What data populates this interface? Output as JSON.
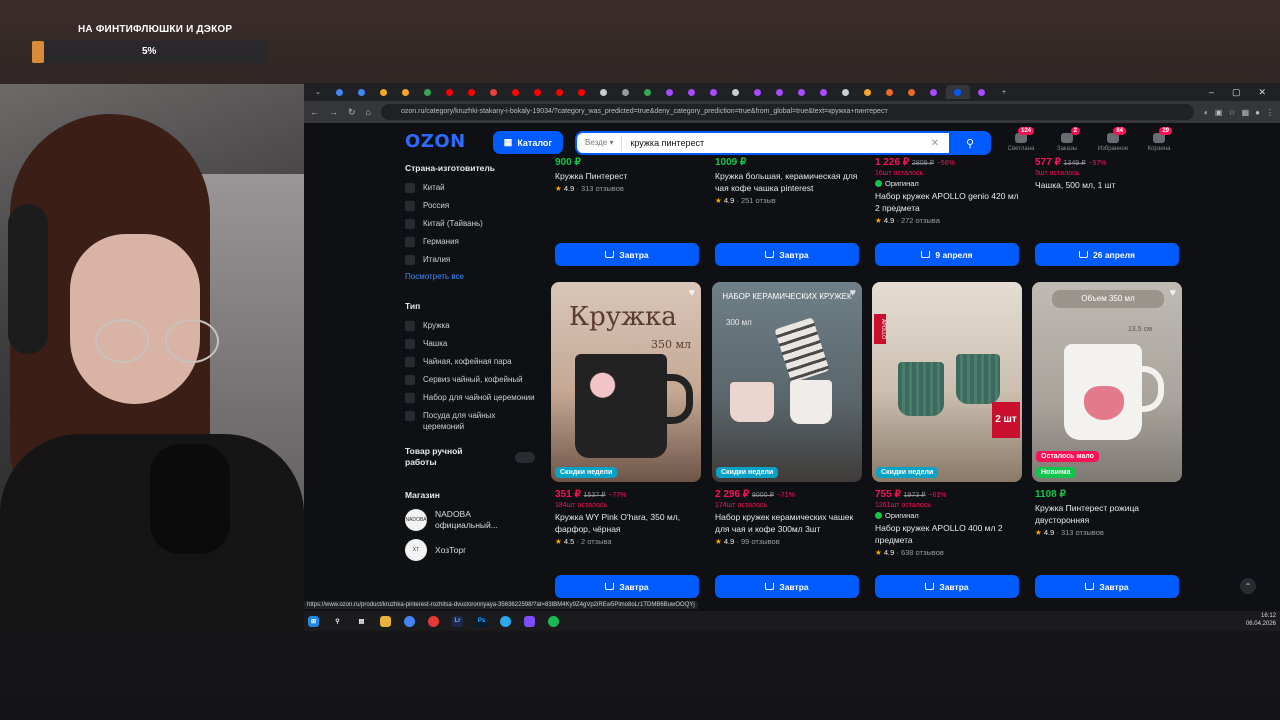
{
  "overlay": {
    "goal_title": "НА ФИНТИФЛЮШКИ И ДЭКОР",
    "goal_percent": "5%",
    "goal_fraction": 0.05
  },
  "browser": {
    "url": "ozon.ru/category/kruzhki-stakany-i-bokaly-19034/?category_was_predicted=true&deny_category_prediction=true&from_global=true&text=кружка+пинтерест",
    "status_url": "https://www.ozon.ru/product/kruzhka-pinterest-rozhitsa-dvustoronnyaya-3563622598/?at=83tBM4Ky9Z4gVp2iREw5Plmo8oLr1TDMB6BuwOOQYj"
  },
  "header": {
    "logo": "OZON",
    "catalog_label": "Каталог",
    "search_scope": "Везде",
    "search_query": "кружка пинтерест",
    "icons": [
      {
        "label": "Светлана",
        "badge": "124"
      },
      {
        "label": "Заказы",
        "badge": "2"
      },
      {
        "label": "Избранное",
        "badge": "84"
      },
      {
        "label": "Корзина",
        "badge": "29"
      }
    ]
  },
  "sidebar": {
    "country_heading": "Страна-изготовитель",
    "countries": [
      "Китай",
      "Россия",
      "Китай (Тайвань)",
      "Германия",
      "Италия"
    ],
    "see_all": "Посмотреть все",
    "type_heading": "Тип",
    "types": [
      "Кружка",
      "Чашка",
      "Чайная, кофейная пара",
      "Сервиз чайный, кофейный",
      "Набор для чайной церемонии",
      "Посуда для чайных церемоний"
    ],
    "used_toggle": "Товар ручной работы",
    "shop_heading": "Магазин",
    "shops": [
      {
        "name": "NADOBA официальный...",
        "logo": "NADOBA"
      },
      {
        "name": "ХозТорг",
        "logo": "ХТ"
      }
    ]
  },
  "row1": [
    {
      "price": "900 ₽",
      "old": "",
      "disc": "",
      "stock": "",
      "original": "",
      "name": "Кружка Пинтерест",
      "rating": "4.9",
      "reviews": "313 отзывов",
      "button": "Завтра"
    },
    {
      "price": "1009 ₽",
      "old": "",
      "disc": "",
      "stock": "",
      "original": "",
      "name": "Кружка большая, керамическая для чая кофе чашка pinterest",
      "rating": "4.9",
      "reviews": "251 отзыв",
      "button": "Завтра"
    },
    {
      "price": "1 226 ₽",
      "old": "2809 ₽",
      "disc": "−56%",
      "stock": "16шт осталось",
      "original": "Оригинал",
      "name": "Набор кружек APOLLO genio 420 мл 2 предмета",
      "rating": "4.9",
      "reviews": "272 отзыва",
      "button": "9 апреля"
    },
    {
      "price": "577 ₽",
      "old": "1349 ₽",
      "disc": "−57%",
      "stock": "3шт осталось",
      "original": "",
      "name": "Чашка, 500 мл, 1 шт",
      "rating": "",
      "reviews": "",
      "button": "26 апреля"
    }
  ],
  "row2": [
    {
      "img_text": "Кружка",
      "img_sub": "350 мл",
      "tag": "Скидки недели",
      "price": "351 ₽",
      "old": "1537 ₽",
      "disc": "−77%",
      "stock": "184шт осталось",
      "original": "",
      "name": "Кружка WY Pink O'hara, 350 мл, фарфор, чёрная",
      "rating": "4.5",
      "reviews": "2 отзыва",
      "button": "Завтра"
    },
    {
      "img_text": "НАБОР КЕРАМИЧЕСКИХ КРУЖЕК",
      "img_sub": "300 мл",
      "tag": "Скидки недели",
      "price": "2 296 ₽",
      "old": "8000 ₽",
      "disc": "−71%",
      "stock": "174шт осталось",
      "original": "",
      "name": "Набор кружек керамических чашек для чая и кофе 300мл 3шт",
      "rating": "4.9",
      "reviews": "99 отзывов",
      "button": "Завтра"
    },
    {
      "img_text": "APOLLO",
      "img_sub": "2 шт",
      "tag": "Скидки недели",
      "price": "755 ₽",
      "old": "1973 ₽",
      "disc": "−61%",
      "stock": "1261шт осталось",
      "original": "Оригинал",
      "name": "Набор кружек APOLLO 400 мл 2 предмета",
      "rating": "4.9",
      "reviews": "638 отзывов",
      "button": "Завтра"
    },
    {
      "img_text": "Объем 350 мл",
      "img_sub": "13.5 см",
      "tag": "Новинка",
      "low": "Осталось мало",
      "price": "1108 ₽",
      "old": "",
      "disc": "",
      "stock": "",
      "original": "",
      "name": "Кружка Пинтерест рожица двусторонняя",
      "rating": "4.9",
      "reviews": "313 отзывов",
      "button": "Завтра"
    }
  ],
  "taskbar": {
    "time": "16:12",
    "date": "06.04.2026"
  },
  "colors": {
    "accent": "#005bff",
    "sale": "#f91155",
    "new": "#10c44c"
  }
}
